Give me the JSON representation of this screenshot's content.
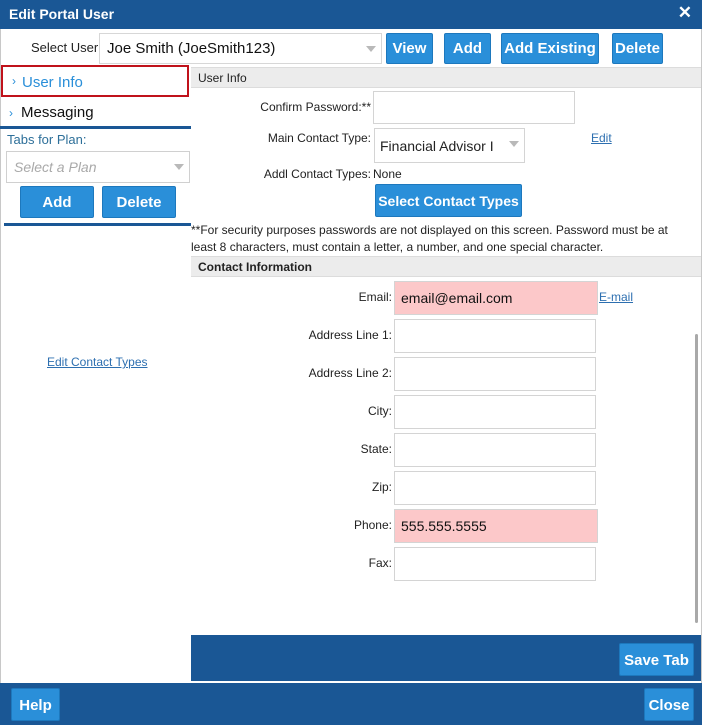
{
  "window": {
    "title": "Edit Portal User",
    "close_glyph": "✕"
  },
  "user_select": {
    "label": "Select User:",
    "value": "Joe Smith (JoeSmith123)",
    "buttons": {
      "view": "View",
      "add": "Add",
      "add_existing": "Add Existing",
      "delete": "Delete"
    }
  },
  "left_nav": {
    "tabs": [
      {
        "label": "User Info",
        "arrow": "›"
      },
      {
        "label": "Messaging",
        "arrow": "›"
      }
    ],
    "plan_label": "Tabs for Plan:",
    "plan_placeholder": "Select a Plan",
    "add_label": "Add",
    "delete_label": "Delete",
    "edit_contact_types": "Edit Contact Types"
  },
  "user_info": {
    "heading": "User Info",
    "confirm_password_label": "Confirm Password:**",
    "confirm_password_value": "",
    "main_contact_label": "Main Contact Type:",
    "main_contact_value": "Financial Advisor I",
    "edit_link": "Edit",
    "addl_contact_label": "Addl Contact Types:",
    "addl_contact_value": "None",
    "select_contact_types_button": "Select Contact Types",
    "security_note": "**For security purposes passwords are not displayed on this screen. Password must be at least 8 characters, must contain a letter, a number, and one special character."
  },
  "contact_info": {
    "heading": "Contact Information",
    "email_label": "Email:",
    "email_value": "email@email.com",
    "email_link": "E-mail",
    "address1_label": "Address Line 1:",
    "address1_value": "",
    "address2_label": "Address Line 2:",
    "address2_value": "",
    "city_label": "City:",
    "city_value": "",
    "state_label": "State:",
    "state_value": "",
    "zip_label": "Zip:",
    "zip_value": "",
    "phone_label": "Phone:",
    "phone_value": "555.555.5555",
    "fax_label": "Fax:",
    "fax_value": "",
    "highlight_color": "#fcc8c9"
  },
  "footer": {
    "save_tab": "Save Tab",
    "help": "Help",
    "close": "Close"
  },
  "colors": {
    "primary_bar": "#1a5795",
    "button": "#2a8fd9",
    "active_tab_border": "#c0121b"
  }
}
